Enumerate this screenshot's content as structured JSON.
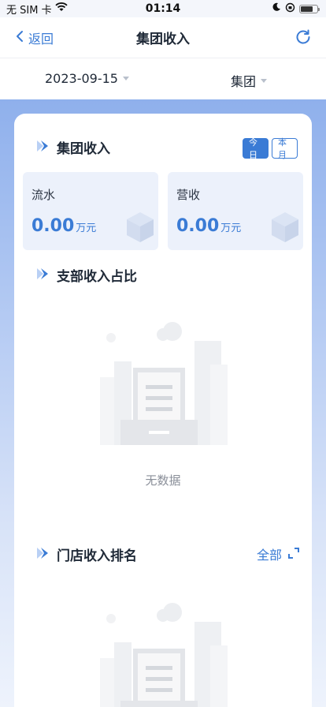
{
  "status_bar": {
    "carrier": "无 SIM 卡",
    "time": "01:14"
  },
  "nav": {
    "back_label": "返回",
    "title": "集团收入"
  },
  "filters": {
    "date": "2023-09-15",
    "group": "集团"
  },
  "section_income": {
    "title": "集团收入",
    "tabs": [
      {
        "label": "今日",
        "active": true
      },
      {
        "label": "本月",
        "active": false
      }
    ],
    "stats": [
      {
        "label": "流水",
        "value": "0.00",
        "unit": "万元"
      },
      {
        "label": "营收",
        "value": "0.00",
        "unit": "万元"
      }
    ]
  },
  "section_branch": {
    "title": "支部收入占比",
    "empty_text": "无数据"
  },
  "section_store": {
    "title": "门店收入排名",
    "all_label": "全部"
  },
  "colors": {
    "accent": "#3a7bd5",
    "card_bg": "#ecf1fb",
    "bg_gradient_top": "#8fb0ec",
    "bg_gradient_bottom": "#eef3fc"
  },
  "icons": {
    "back": "chevron-left-icon",
    "refresh": "refresh-icon",
    "section": "section-marker-icon",
    "stat": "cube-icon",
    "empty": "empty-document-icon",
    "expand": "expand-icon"
  }
}
